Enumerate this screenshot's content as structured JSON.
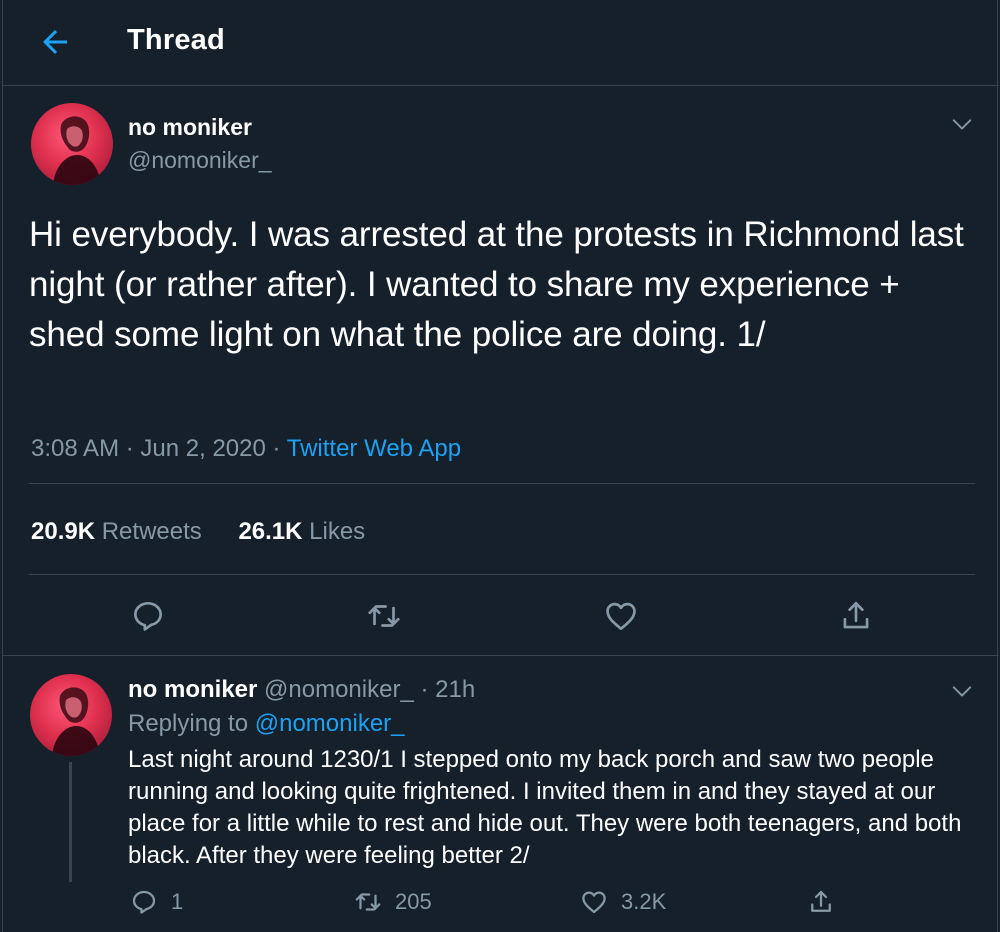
{
  "header": {
    "title": "Thread",
    "back_icon": "back-arrow-icon"
  },
  "colors": {
    "background": "#15202b",
    "accent": "#1da1f2",
    "muted": "#8899a6",
    "border": "#38444d"
  },
  "main_tweet": {
    "display_name": "no moniker",
    "handle": "@nomoniker_",
    "text": "Hi everybody.  I was arrested at the protests in Richmond last night (or rather after).  I wanted to share my experience + shed some light on what the police are doing. 1/",
    "time": "3:08 AM",
    "date": "Jun 2, 2020",
    "separator": "·",
    "source": "Twitter Web App",
    "retweets_count": "20.9K",
    "retweets_label": "Retweets",
    "likes_count": "26.1K",
    "likes_label": "Likes",
    "icons": [
      "reply-icon",
      "retweet-icon",
      "like-icon",
      "share-icon"
    ]
  },
  "reply_tweet": {
    "display_name": "no moniker",
    "handle": "@nomoniker_",
    "separator": "·",
    "age": "21h",
    "replying_to_label": "Replying to",
    "replying_to_handle": "@nomoniker_",
    "text": "Last night around 1230/1 I stepped onto my back porch and saw two people running and looking quite frightened.  I invited them in and they stayed at our place for a little while to rest and hide out. They were both teenagers, and both black.  After they were feeling better 2/",
    "reply_count": "1",
    "retweet_count": "205",
    "like_count": "3.2K"
  }
}
